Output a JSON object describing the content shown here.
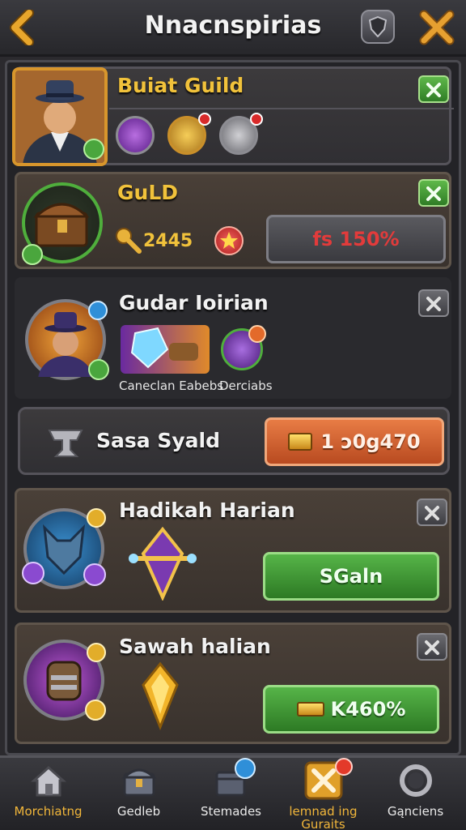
{
  "header": {
    "title": "Nnacnspirias"
  },
  "panels": {
    "guild_build": {
      "title": "Buiat Guild"
    },
    "guild_chest": {
      "title": "GuLD",
      "amount": "2445",
      "button": "fs 150%"
    },
    "guardian": {
      "title": "Gudar Ioirian",
      "caption_left": "Caneclan Eabebs",
      "caption_right": "Derciabs"
    },
    "sasa": {
      "title": "Sasa Syald",
      "button": "1 ɔ0g470"
    },
    "hadikah": {
      "title": "Hadikah Harian",
      "button": "SGaln"
    },
    "sawah": {
      "title": "Sawah halian",
      "button": "K460%"
    }
  },
  "nav": {
    "items": [
      {
        "label": "Morchiatng"
      },
      {
        "label": "Gedleb"
      },
      {
        "label": "Stemades"
      },
      {
        "label": "lemnad ing Guraits"
      },
      {
        "label": "Gąnciens"
      }
    ]
  },
  "colors": {
    "accent_gold": "#f1c23b",
    "button_green": "#4aa63d",
    "button_orange": "#d9642f",
    "price_red": "#e23b3b",
    "background": "#2b2a2e"
  },
  "icons": {
    "back": "chevron-left-icon",
    "shield": "shield-icon",
    "tools": "crossed-tools-icon",
    "close": "close-icon"
  }
}
